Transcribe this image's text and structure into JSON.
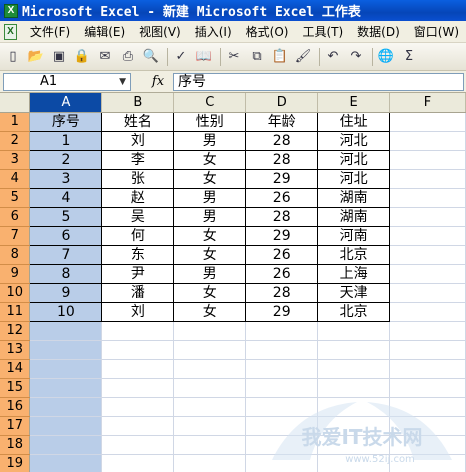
{
  "window": {
    "title": "Microsoft Excel - 新建 Microsoft Excel 工作表"
  },
  "menu": {
    "items": [
      "文件(F)",
      "编辑(E)",
      "视图(V)",
      "插入(I)",
      "格式(O)",
      "工具(T)",
      "数据(D)",
      "窗口(W)"
    ]
  },
  "toolbar": {
    "icons": [
      "new-icon",
      "open-icon",
      "save-icon",
      "permission-icon",
      "email-icon",
      "print-icon",
      "print-preview-icon",
      "spelling-icon",
      "cut-icon",
      "copy-icon",
      "paste-icon",
      "format-painter-icon",
      "undo-icon",
      "redo-icon",
      "hyperlink-icon",
      "autosum-icon"
    ]
  },
  "formula_bar": {
    "name_box": "A1",
    "fx_label": "fx",
    "value": "序号"
  },
  "sheet": {
    "columns": [
      "A",
      "B",
      "C",
      "D",
      "E",
      "F"
    ],
    "row_numbers": [
      "1",
      "2",
      "3",
      "4",
      "5",
      "6",
      "7",
      "8",
      "9",
      "10",
      "11",
      "12",
      "13",
      "14",
      "15",
      "16",
      "17",
      "18",
      "19"
    ],
    "selected_column": "A",
    "header": [
      "序号",
      "姓名",
      "性别",
      "年龄",
      "住址"
    ],
    "rows": [
      [
        "1",
        "刘",
        "男",
        "28",
        "河北"
      ],
      [
        "2",
        "李",
        "女",
        "28",
        "河北"
      ],
      [
        "3",
        "张",
        "女",
        "29",
        "河北"
      ],
      [
        "4",
        "赵",
        "男",
        "26",
        "湖南"
      ],
      [
        "5",
        "吴",
        "男",
        "28",
        "湖南"
      ],
      [
        "6",
        "何",
        "女",
        "29",
        "河南"
      ],
      [
        "7",
        "东",
        "女",
        "26",
        "北京"
      ],
      [
        "8",
        "尹",
        "男",
        "26",
        "上海"
      ],
      [
        "9",
        "潘",
        "女",
        "28",
        "天津"
      ],
      [
        "10",
        "刘",
        "女",
        "29",
        "北京"
      ]
    ]
  },
  "watermark": {
    "text": "我爱IT技术网",
    "url": "www.52ij.com"
  },
  "colors": {
    "title_bar": "#0a5fe0",
    "selected_column": "#b9cde8",
    "row_header": "#f9b16f",
    "column_header_selected": "#0c4aa5"
  }
}
